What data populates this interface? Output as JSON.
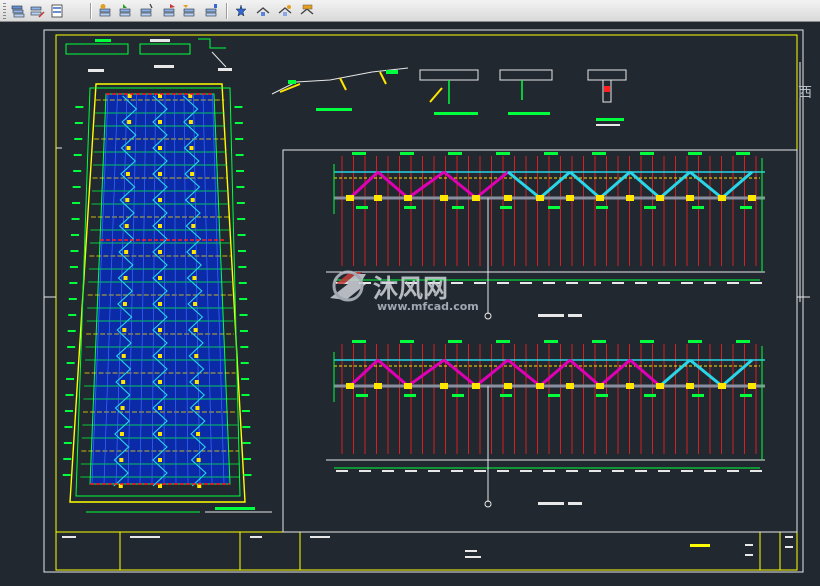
{
  "toolbar": {
    "buttons": [
      {
        "icon": "stack-layers-icon"
      },
      {
        "icon": "layer-edit-icon"
      },
      {
        "icon": "layer-states-icon"
      },
      {
        "icon": "layer-previous-icon"
      },
      {
        "icon": "layer-match-icon"
      },
      {
        "icon": "layer-isolate-icon"
      },
      {
        "icon": "layer-unisolate-icon"
      },
      {
        "icon": "layer-off-icon"
      },
      {
        "icon": "layer-freeze-icon"
      },
      {
        "icon": "layer-lock-icon"
      },
      {
        "icon": "layer-walk-icon"
      },
      {
        "icon": "layer-merge-icon"
      },
      {
        "icon": "layer-delete-icon"
      }
    ]
  },
  "drawing": {
    "side_label": "西",
    "watermark": {
      "brand": "沐风网",
      "url": "www.mfcad.com"
    }
  },
  "colors": {
    "background": "#212830",
    "frame": "#e8e8e8",
    "title_line": "#ffff00",
    "green": "#00ff3c",
    "red": "#ff2020",
    "magenta": "#e000b4",
    "cyan": "#28d6e8",
    "blue_fill": "#0a2aa8",
    "yellow": "#ffe600",
    "watermark": "#b8bec8"
  }
}
